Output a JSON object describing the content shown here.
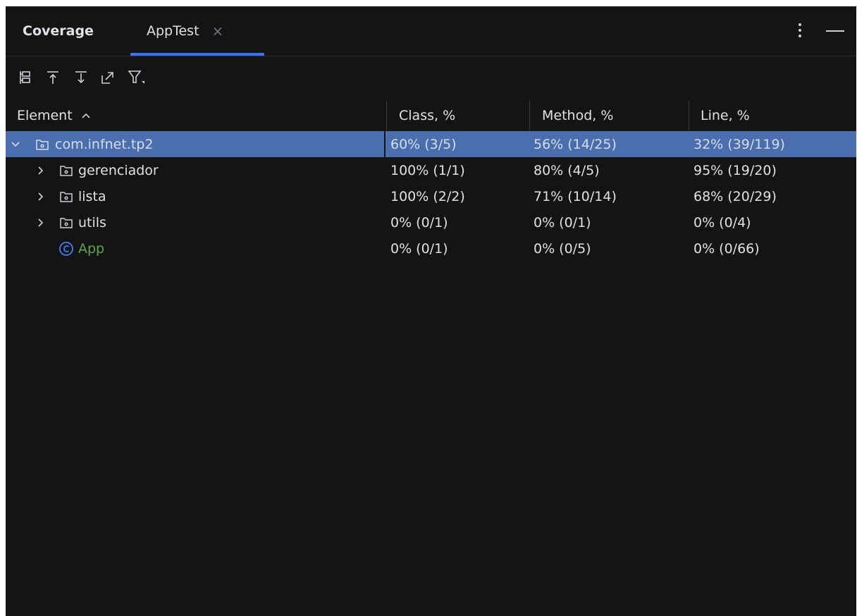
{
  "tabs": [
    {
      "label": "Coverage",
      "active": false
    },
    {
      "label": "AppTest",
      "active": true,
      "closable": true
    }
  ],
  "tab_close_glyph": "×",
  "toolbar": {
    "icons": [
      "flatten-packages-icon",
      "navigate-up-icon",
      "navigate-down-icon",
      "open-in-editor-icon",
      "filter-icon"
    ]
  },
  "table": {
    "headers": {
      "element": "Element",
      "sort_glyph": "^",
      "class": "Class, %",
      "method": "Method, %",
      "line": "Line, %"
    },
    "rows": [
      {
        "name": "com.infnet.tp2",
        "type": "package",
        "expanded": true,
        "selected": true,
        "class": "60% (3/5)",
        "method": "56% (14/25)",
        "line": "32% (39/119)"
      },
      {
        "name": "gerenciador",
        "type": "package",
        "expanded": false,
        "selected": false,
        "class": "100% (1/1)",
        "method": "80% (4/5)",
        "line": "95% (19/20)"
      },
      {
        "name": "lista",
        "type": "package",
        "expanded": false,
        "selected": false,
        "class": "100% (2/2)",
        "method": "71% (10/14)",
        "line": "68% (20/29)"
      },
      {
        "name": "utils",
        "type": "package",
        "expanded": false,
        "selected": false,
        "class": "0% (0/1)",
        "method": "0% (0/1)",
        "line": "0% (0/4)"
      },
      {
        "name": "App",
        "type": "class",
        "expanded": false,
        "selected": false,
        "class": "0% (0/1)",
        "method": "0% (0/5)",
        "line": "0% (0/66)"
      }
    ]
  },
  "colors": {
    "background": "#141414",
    "selection": "#4b6eaf",
    "tab_underline": "#3574f0",
    "class_name": "#5fa54c",
    "class_icon": "#3e7ef8"
  }
}
